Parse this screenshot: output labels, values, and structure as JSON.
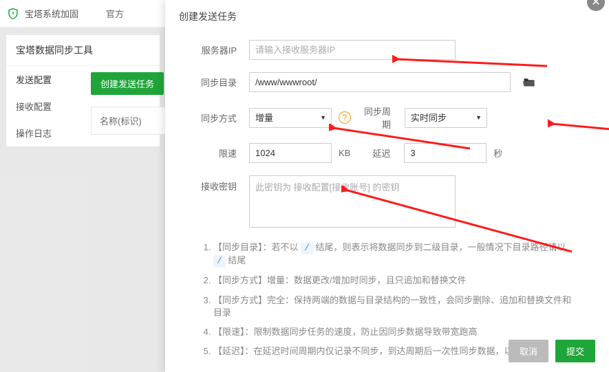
{
  "bg": {
    "top_title": "宝塔系统加固",
    "top_tab": "官方",
    "panel_title": "宝塔数据同步工具",
    "nav": [
      "发送配置",
      "接收配置",
      "操作日志"
    ],
    "create_btn": "创建发送任务",
    "name_label": "名称(标识)"
  },
  "modal": {
    "title": "创建发送任务",
    "labels": {
      "server_ip": "服务器IP",
      "sync_dir": "同步目录",
      "sync_mode": "同步方式",
      "sync_cycle": "同步周期",
      "speed": "限速",
      "delay": "延迟",
      "key": "接收密钥"
    },
    "placeholders": {
      "ip": "请输入接收服务器IP",
      "key": "此密钥为 接收配置[接收账号] 的密钥"
    },
    "values": {
      "dir": "/www/wwwroot/",
      "mode": "增量",
      "cycle": "实时同步",
      "speed": "1024",
      "delay": "3"
    },
    "units": {
      "kb": "KB",
      "sec": "秒"
    },
    "notes": [
      {
        "prefix": "【同步目录】：若不以 ",
        "mid": " 结尾，则表示将数据同步到二级目录，一般情况下目录路径请以 ",
        "suffix": " 结尾"
      },
      {
        "text": "【同步方式】增量：数据更改/增加时同步，且只追加和替换文件"
      },
      {
        "text": "【同步方式】完全：保持两端的数据与目录结构的一致性，会同步删除、追加和替换文件和目录"
      },
      {
        "text": "【限速】：限制数据同步任务的速度，防止因同步数据导致带宽跑高"
      },
      {
        "text": "【延迟】：在延迟时间周期内仅记录不同步，到达周期后一次性同步数据，以节省开销"
      }
    ],
    "slash": "/",
    "cancel": "取消",
    "submit": "提交"
  }
}
